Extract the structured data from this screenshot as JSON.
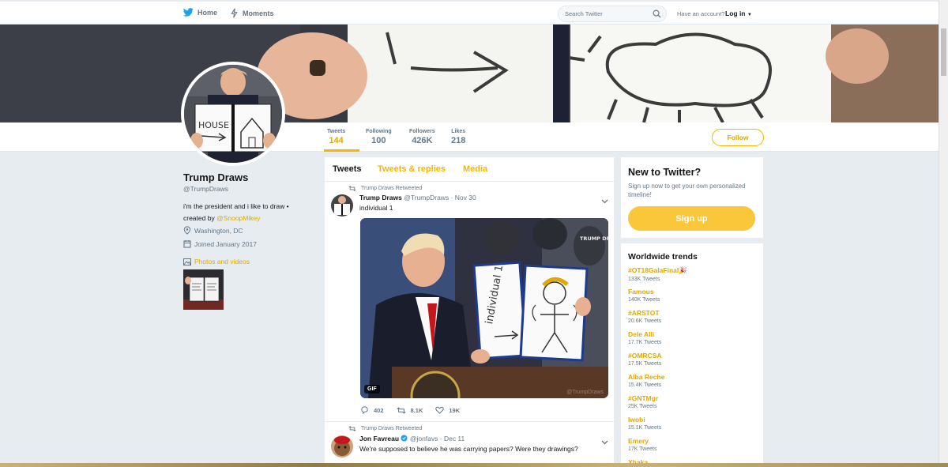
{
  "topnav": {
    "home_label": "Home",
    "moments_label": "Moments",
    "search_placeholder": "Search Twitter",
    "account_prompt": "Have an account?",
    "login_label": "Log in",
    "accent_color": "#1da1f2"
  },
  "profile_nav": {
    "stats": [
      {
        "label": "Tweets",
        "value": "144"
      },
      {
        "label": "Following",
        "value": "100"
      },
      {
        "label": "Followers",
        "value": "426K"
      },
      {
        "label": "Likes",
        "value": "218"
      }
    ],
    "follow_label": "Follow"
  },
  "profile": {
    "name": "Trump Draws",
    "handle": "@TrumpDraws",
    "bio": "i'm the president and i like to draw • created by",
    "bio_mention": "@SnoopMikey",
    "location": "Washington, DC",
    "joined": "Joined January 2017",
    "photos_label": "Photos and videos",
    "avatar_drawing_text": "HOUSE"
  },
  "timeline": {
    "tabs": [
      "Tweets",
      "Tweets & replies",
      "Media"
    ],
    "tweets": [
      {
        "retweet_label": "Trump Draws Retweeted",
        "name": "Trump Draws",
        "handle": "@TrumpDraws",
        "date": "· Nov 30",
        "text": "individual 1",
        "media_badge": "GIF",
        "media_watermark": "@TrumpDraws",
        "media_logo": "TRUMP DRAWS",
        "drawing_text": "individual 1",
        "replies": "402",
        "retweets": "8.1K",
        "likes": "19K"
      },
      {
        "retweet_label": "Trump Draws Retweeted",
        "name": "Jon Favreau",
        "handle": "@jonfavs",
        "date": "· Dec 11",
        "text": "We're supposed to believe he was carrying papers? Were they drawings?"
      }
    ]
  },
  "new_to_twitter": {
    "heading": "New to Twitter?",
    "subtext": "Sign up now to get your own personalized timeline!",
    "signup_label": "Sign up"
  },
  "trends": {
    "heading": "Worldwide trends",
    "items": [
      {
        "name": "#OT18GalaFinal🎉",
        "count": "133K Tweets"
      },
      {
        "name": "Famous",
        "count": "140K Tweets"
      },
      {
        "name": "#ARSTOT",
        "count": "20.6K Tweets"
      },
      {
        "name": "Dele Alli",
        "count": "17.7K Tweets"
      },
      {
        "name": "#OMRCSA",
        "count": "17.5K Tweets"
      },
      {
        "name": "Alba Reche",
        "count": "15.4K Tweets"
      },
      {
        "name": "#GNTMgr",
        "count": "25K Tweets"
      },
      {
        "name": "Iwobi",
        "count": "15.1K Tweets"
      },
      {
        "name": "Emery",
        "count": "17K Tweets"
      },
      {
        "name": "Xhaka",
        "count": ""
      }
    ]
  }
}
